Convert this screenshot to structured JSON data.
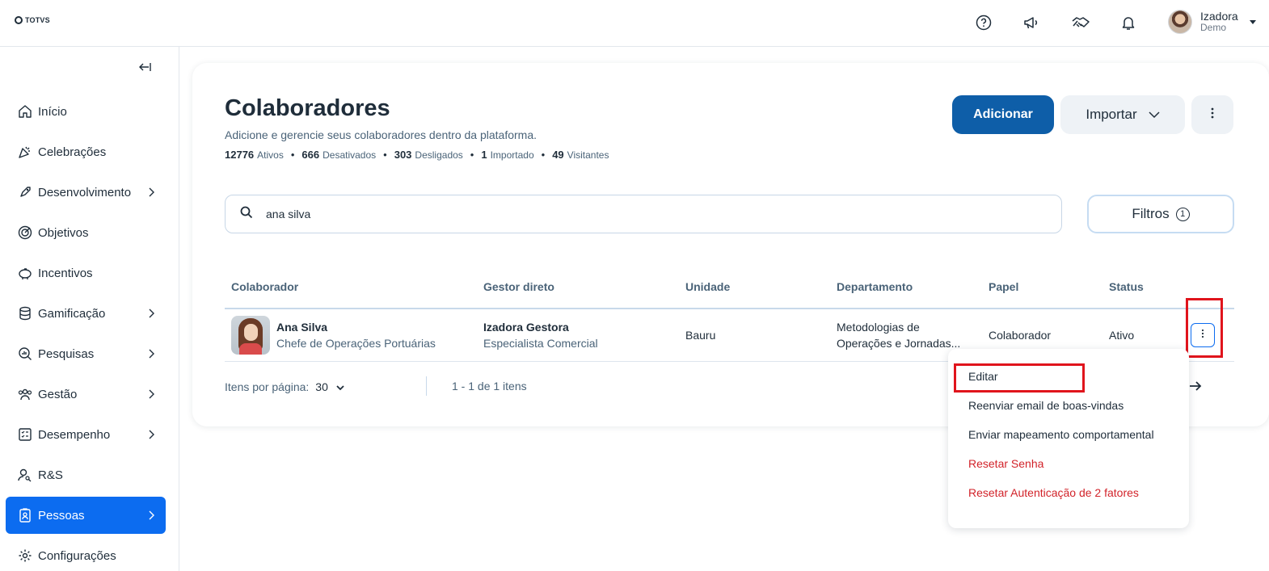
{
  "brand": {
    "logo_text": "TOTVS"
  },
  "topbar": {
    "icons": [
      "help-icon",
      "megaphone-icon",
      "handshake-icon",
      "bell-icon"
    ],
    "user": {
      "name": "Izadora",
      "role": "Demo"
    }
  },
  "sidebar": {
    "items": [
      {
        "label": "Início",
        "icon": "home-icon",
        "has_submenu": false,
        "active": false
      },
      {
        "label": "Celebrações",
        "icon": "party-icon",
        "has_submenu": false,
        "active": false
      },
      {
        "label": "Desenvolvimento",
        "icon": "rocket-icon",
        "has_submenu": true,
        "active": false
      },
      {
        "label": "Objetivos",
        "icon": "target-icon",
        "has_submenu": false,
        "active": false
      },
      {
        "label": "Incentivos",
        "icon": "piggy-bank-icon",
        "has_submenu": false,
        "active": false
      },
      {
        "label": "Gamificação",
        "icon": "coins-icon",
        "has_submenu": true,
        "active": false
      },
      {
        "label": "Pesquisas",
        "icon": "search-chart-icon",
        "has_submenu": true,
        "active": false
      },
      {
        "label": "Gestão",
        "icon": "people-icon",
        "has_submenu": true,
        "active": false
      },
      {
        "label": "Desempenho",
        "icon": "checklist-icon",
        "has_submenu": true,
        "active": false
      },
      {
        "label": "R&S",
        "icon": "person-search-icon",
        "has_submenu": false,
        "active": false
      },
      {
        "label": "Pessoas",
        "icon": "badge-icon",
        "has_submenu": true,
        "active": true
      },
      {
        "label": "Configurações",
        "icon": "gear-icon",
        "has_submenu": false,
        "active": false
      }
    ]
  },
  "page": {
    "title": "Colaboradores",
    "subtitle": "Adicione e gerencie seus colaboradores dentro da plataforma.",
    "stats": [
      {
        "count": "12776",
        "label": "Ativos"
      },
      {
        "count": "666",
        "label": "Desativados"
      },
      {
        "count": "303",
        "label": "Desligados"
      },
      {
        "count": "1",
        "label": "Importado"
      },
      {
        "count": "49",
        "label": "Visitantes"
      }
    ],
    "add_label": "Adicionar",
    "import_label": "Importar",
    "search_value": "ana silva",
    "filter_label": "Filtros",
    "filter_count": "1"
  },
  "table": {
    "columns": [
      "Colaborador",
      "Gestor direto",
      "Unidade",
      "Departamento",
      "Papel",
      "Status"
    ],
    "rows": [
      {
        "name": "Ana Silva",
        "title": "Chefe de Operações Portuárias",
        "manager": "Izadora Gestora",
        "manager_title": "Especialista Comercial",
        "unit": "Bauru",
        "department_line1": "Metodologias de",
        "department_line2": "Operações e Jornadas...",
        "role": "Colaborador",
        "status": "Ativo"
      }
    ]
  },
  "pagination": {
    "per_page_label": "Itens por página:",
    "per_page_value": "30",
    "range": "1 - 1 de 1 itens"
  },
  "row_menu": {
    "items": [
      {
        "label": "Editar",
        "danger": false
      },
      {
        "label": "Reenviar email de boas-vindas",
        "danger": false
      },
      {
        "label": "Enviar mapeamento comportamental",
        "danger": false
      },
      {
        "label": "Resetar Senha",
        "danger": true
      },
      {
        "label": "Resetar Autenticação de 2 fatores",
        "danger": true
      }
    ]
  },
  "colors": {
    "primary": "#0e5ea8",
    "active_nav": "#0c6cf0",
    "danger": "#d2232a",
    "highlight": "#e0141c"
  }
}
